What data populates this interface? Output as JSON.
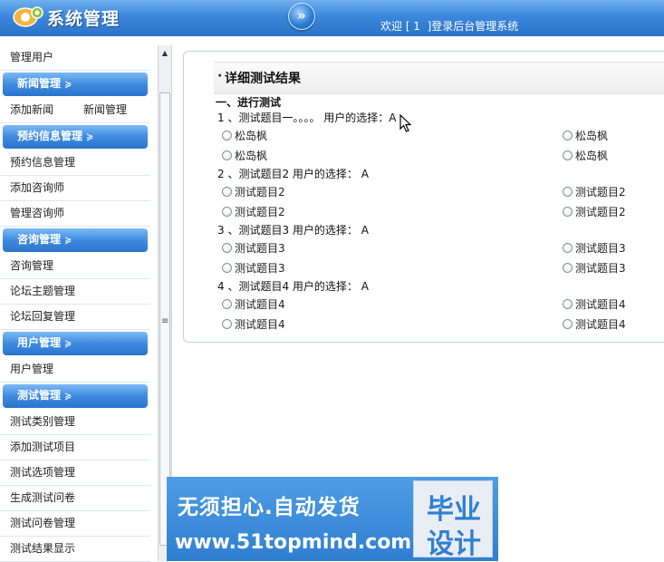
{
  "header": {
    "app_title": "系统管理",
    "toggle_glyph": "»",
    "welcome": "欢迎 [ 1  ]登录后台管理系统"
  },
  "sidebar": {
    "top_item": "管理用户",
    "groups": [
      {
        "title": "新闻管理",
        "items": [
          {
            "left": "添加新闻",
            "right": "新闻管理"
          }
        ]
      },
      {
        "title": "预约信息管理",
        "items": [
          "预约信息管理",
          "添加咨询师",
          "管理咨询师"
        ]
      },
      {
        "title": "咨询管理",
        "items": [
          "咨询管理",
          "论坛主题管理",
          "论坛回复管理"
        ]
      },
      {
        "title": "用户管理",
        "items": [
          "用户管理"
        ]
      },
      {
        "title": "测试管理",
        "items": [
          "测试类别管理",
          "添加测试项目",
          "测试选项管理",
          "生成测试问卷",
          "测试问卷管理",
          "测试结果显示"
        ]
      }
    ]
  },
  "main": {
    "title": "详细测试结果",
    "section": "一、进行测试",
    "questions": [
      {
        "line": "1 、测试题目一。。。。 用户的选择：A",
        "options": [
          "松岛枫",
          "松岛枫",
          "松岛枫",
          "松岛枫"
        ]
      },
      {
        "line": "2 、测试题目2 用户的选择： A",
        "options": [
          "测试题目2",
          "测试题目2",
          "测试题目2",
          "测试题目2"
        ]
      },
      {
        "line": "3 、测试题目3 用户的选择： A",
        "options": [
          "测试题目3",
          "测试题目3",
          "测试题目3",
          "测试题目3"
        ]
      },
      {
        "line": "4 、测试题目4 用户的选择： A",
        "options": [
          "测试题目4",
          "测试题目4",
          "测试题目4",
          "测试题目4"
        ]
      }
    ]
  },
  "banner": {
    "slogan": "无须担心.自动发货",
    "url": "www.51topmind.com",
    "word1": "毕业",
    "word2": "设计"
  },
  "colors": {
    "header_blue": "#3b87db",
    "menu_header_blue": "#3f8be0",
    "banner_blue": "#2f7fd2"
  }
}
